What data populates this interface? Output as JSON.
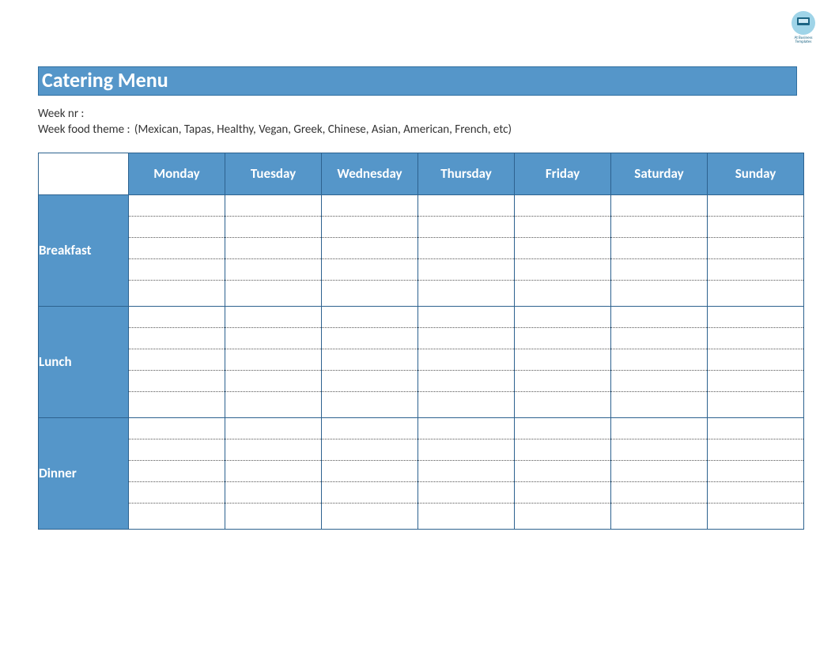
{
  "logo_text": "At Business Templates",
  "title": "Catering Menu",
  "meta": {
    "week_nr_label": "Week nr :",
    "week_nr_value": "",
    "theme_label": "Week food theme :",
    "theme_value": "(Mexican, Tapas, Healthy, Vegan, Greek, Chinese, Asian, American, French, etc)"
  },
  "days": [
    "Monday",
    "Tuesday",
    "Wednesday",
    "Thursday",
    "Friday",
    "Saturday",
    "Sunday"
  ],
  "meals": [
    "Breakfast",
    "Lunch",
    "Dinner"
  ],
  "rows_per_meal": 5,
  "grid": {
    "Breakfast": {
      "Monday": [
        "",
        "",
        "",
        "",
        ""
      ],
      "Tuesday": [
        "",
        "",
        "",
        "",
        ""
      ],
      "Wednesday": [
        "",
        "",
        "",
        "",
        ""
      ],
      "Thursday": [
        "",
        "",
        "",
        "",
        ""
      ],
      "Friday": [
        "",
        "",
        "",
        "",
        ""
      ],
      "Saturday": [
        "",
        "",
        "",
        "",
        ""
      ],
      "Sunday": [
        "",
        "",
        "",
        "",
        ""
      ]
    },
    "Lunch": {
      "Monday": [
        "",
        "",
        "",
        "",
        ""
      ],
      "Tuesday": [
        "",
        "",
        "",
        "",
        ""
      ],
      "Wednesday": [
        "",
        "",
        "",
        "",
        ""
      ],
      "Thursday": [
        "",
        "",
        "",
        "",
        ""
      ],
      "Friday": [
        "",
        "",
        "",
        "",
        ""
      ],
      "Saturday": [
        "",
        "",
        "",
        "",
        ""
      ],
      "Sunday": [
        "",
        "",
        "",
        "",
        ""
      ]
    },
    "Dinner": {
      "Monday": [
        "",
        "",
        "",
        "",
        ""
      ],
      "Tuesday": [
        "",
        "",
        "",
        "",
        ""
      ],
      "Wednesday": [
        "",
        "",
        "",
        "",
        ""
      ],
      "Thursday": [
        "",
        "",
        "",
        "",
        ""
      ],
      "Friday": [
        "",
        "",
        "",
        "",
        ""
      ],
      "Saturday": [
        "",
        "",
        "",
        "",
        ""
      ],
      "Sunday": [
        "",
        "",
        "",
        "",
        ""
      ]
    }
  }
}
